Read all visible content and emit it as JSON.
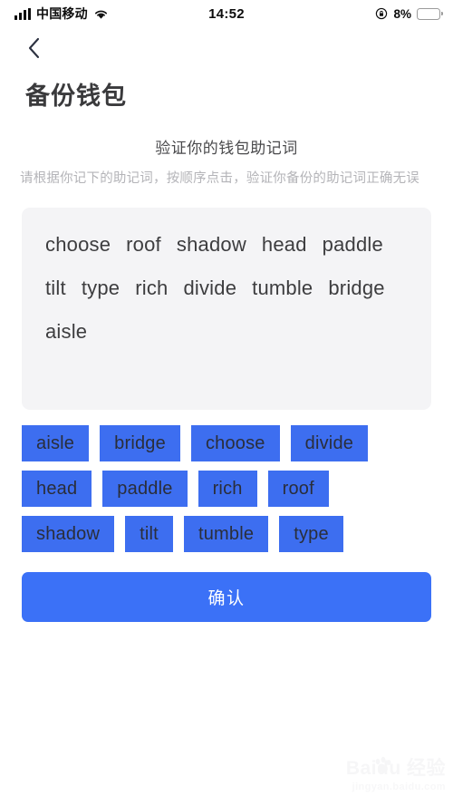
{
  "status_bar": {
    "carrier": "中国移动",
    "time": "14:52",
    "battery_percent": "8%",
    "signal_icon": "signal-bars-icon",
    "wifi_icon": "wifi-icon",
    "rotation_lock_icon": "rotation-lock-icon",
    "battery_icon": "battery-low-icon",
    "battery_fill_color": "#f5341f"
  },
  "nav": {
    "back_icon": "chevron-left-icon"
  },
  "page": {
    "title": "备份钱包",
    "heading": "验证你的钱包助记词",
    "subtitle": "请根据你记下的助记词，按顺序点击，验证你备份的助记词正确无误"
  },
  "mnemonic_panel": {
    "selected_words": [
      "choose",
      "roof",
      "shadow",
      "head",
      "paddle",
      "tilt",
      "type",
      "rich",
      "divide",
      "tumble",
      "bridge",
      "aisle"
    ],
    "background_color": "#f4f4f6"
  },
  "word_chips": {
    "accent_color": "#3d6ef0",
    "items": [
      "aisle",
      "bridge",
      "choose",
      "divide",
      "head",
      "paddle",
      "rich",
      "roof",
      "shadow",
      "tilt",
      "tumble",
      "type"
    ]
  },
  "confirm": {
    "label": "确认",
    "color": "#3b71f7"
  },
  "watermark": {
    "main": "Baidu 经验",
    "sub": "jingyan.baidu.com"
  }
}
